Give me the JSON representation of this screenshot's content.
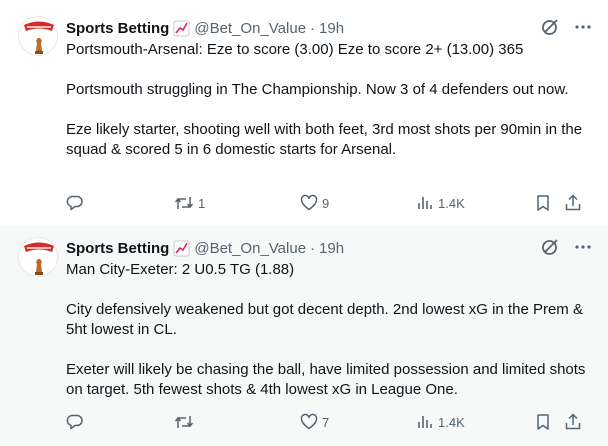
{
  "tweets": [
    {
      "author_name": "Sports Betting",
      "handle": "@Bet_On_Value",
      "separator": "·",
      "time": "19h",
      "text": [
        "Portsmouth-Arsenal: Eze to score (3.00) Eze to score 2+ (13.00) 365",
        "Portsmouth struggling in The Championship. Now 3 of 4 defenders out now.",
        "Eze likely starter, shooting well with both feet, 3rd most shots per 90min in the squad & scored 5 in 6 domestic starts for Arsenal."
      ],
      "reply_count": "",
      "retweet_count": "1",
      "like_count": "9",
      "view_count": "1.4K"
    },
    {
      "author_name": "Sports Betting",
      "handle": "@Bet_On_Value",
      "separator": "·",
      "time": "19h",
      "text": [
        "Man City-Exeter: 2 U0.5 TG (1.88)",
        "City defensively weakened but got decent depth. 2nd lowest xG in the Prem & 5ht lowest in CL.",
        "Exeter will likely be chasing the ball, have limited possession and limited shots on target. 5th fewest shots & 4th lowest xG in League One."
      ],
      "reply_count": "",
      "retweet_count": "",
      "like_count": "7",
      "view_count": "1.4K"
    }
  ],
  "icons": {
    "emoji": "chart-increasing-icon",
    "grok": "grok-icon",
    "more": "more-icon",
    "reply": "reply-icon",
    "retweet": "retweet-icon",
    "like": "like-icon",
    "views": "views-icon",
    "bookmark": "bookmark-icon",
    "share": "share-icon"
  },
  "colors": {
    "text": "#0f1419",
    "secondary": "#536471",
    "hover_bg": "#f7f9f9",
    "avatar_red": "#d42a2a"
  }
}
